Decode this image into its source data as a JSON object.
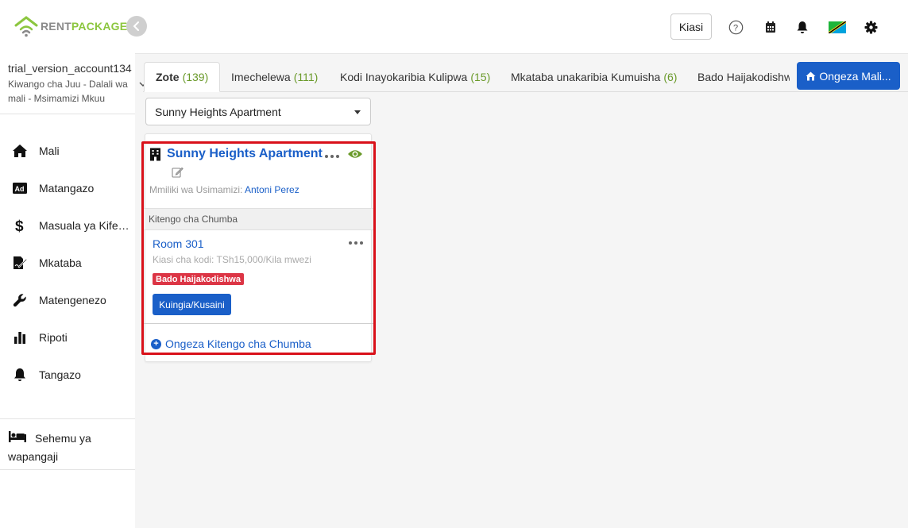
{
  "app": {
    "logo_rent": "RENT",
    "logo_package": "PACKAGE",
    "brand_color": "#8cc63f",
    "accent_color": "#1a5fc8"
  },
  "account": {
    "name": "trial_version_account134",
    "role": "Kiwango cha Juu - Dalali wa mali - Msimamizi Mkuu"
  },
  "sidebar": {
    "items": [
      {
        "label": "Mali",
        "icon": "home-icon"
      },
      {
        "label": "Matangazo",
        "icon": "ad-icon"
      },
      {
        "label": "Masuala ya Kifedha",
        "icon": "dollar-icon"
      },
      {
        "label": "Mkataba",
        "icon": "contract-icon"
      },
      {
        "label": "Matengenezo",
        "icon": "wrench-icon"
      },
      {
        "label": "Ripoti",
        "icon": "bar-chart-icon"
      },
      {
        "label": "Tangazo",
        "icon": "bell-icon"
      }
    ],
    "tenant_label": "Sehemu ya wapangaji"
  },
  "topbar": {
    "kiasi_label": "Kiasi",
    "icons": [
      "help-icon",
      "calendar-icon",
      "notification-bell-icon",
      "tanzania-flag-icon",
      "settings-gear-icon"
    ]
  },
  "tabs": [
    {
      "label": "Zote",
      "count": "(139)"
    },
    {
      "label": "Imechelewa",
      "count": "(111)"
    },
    {
      "label": "Kodi Inayokaribia Kulipwa",
      "count": "(15)"
    },
    {
      "label": "Mkataba unakaribia Kumuisha",
      "count": "(6)"
    },
    {
      "label": "Bado Haijakodishwa",
      "count": ""
    }
  ],
  "add_property_label": "Ongeza Mali...",
  "property_select": {
    "selected": "Sunny Heights Apartment"
  },
  "property_card": {
    "name": "Sunny Heights Apartment",
    "owner_label": "Mmiliki wa Usimamizi:",
    "owner_name": "Antoni Perez",
    "section_label": "Kitengo cha Chumba",
    "room": {
      "name": "Room 301",
      "rent": "Kiasi cha kodi: TSh15,000/Kila mwezi",
      "status": "Bado Haijakodishwa",
      "status_color": "#dc3545",
      "enter_label": "Kuingia/Kusaini"
    },
    "add_unit_label": "Ongeza Kitengo cha Chumba"
  }
}
